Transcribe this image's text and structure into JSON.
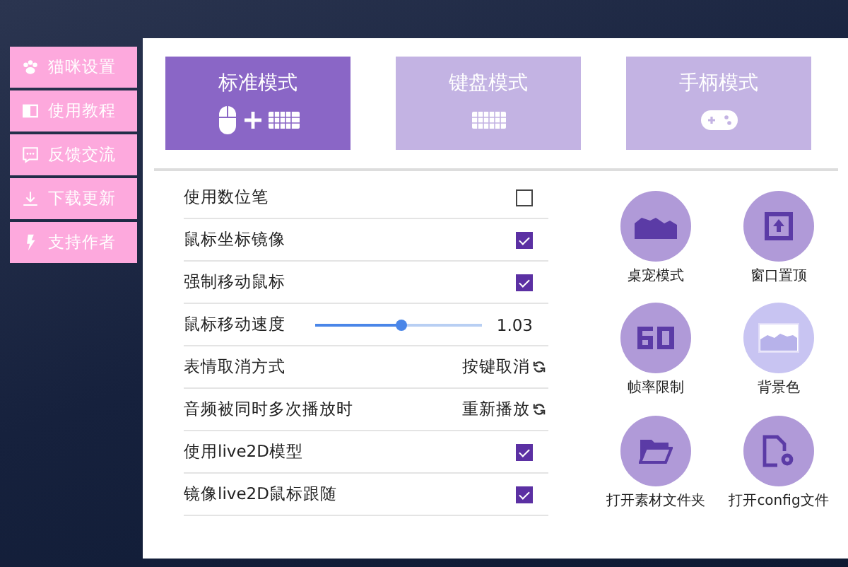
{
  "sidebar": {
    "items": [
      {
        "label": "猫咪设置"
      },
      {
        "label": "使用教程"
      },
      {
        "label": "反馈交流"
      },
      {
        "label": "下载更新"
      },
      {
        "label": "支持作者"
      }
    ]
  },
  "modes": [
    {
      "label": "标准模式",
      "selected": true
    },
    {
      "label": "键盘模式",
      "selected": false
    },
    {
      "label": "手柄模式",
      "selected": false
    }
  ],
  "settings": [
    {
      "kind": "checkbox",
      "label": "使用数位笔",
      "checked": false
    },
    {
      "kind": "checkbox",
      "label": "鼠标坐标镜像",
      "checked": true
    },
    {
      "kind": "checkbox",
      "label": "强制移动鼠标",
      "checked": true
    },
    {
      "kind": "slider",
      "label": "鼠标移动速度",
      "level": 0.51,
      "reading": "1.03"
    },
    {
      "kind": "cycle",
      "label": "表情取消方式",
      "value": "按键取消"
    },
    {
      "kind": "cycle",
      "label": "音频被同时多次播放时",
      "value": "重新播放"
    },
    {
      "kind": "checkbox",
      "label": "使用live2D模型",
      "checked": true
    },
    {
      "kind": "checkbox",
      "label": "镜像live2D鼠标跟随",
      "checked": true
    }
  ],
  "tools": [
    {
      "label": "桌宠模式",
      "color": "#b09ad8"
    },
    {
      "label": "窗口置顶",
      "color": "#b09ad8"
    },
    {
      "label": "帧率限制",
      "color": "#b09ad8"
    },
    {
      "label": "背景色",
      "color": "#c8c4f2"
    },
    {
      "label": "打开素材文件夹",
      "color": "#b09ad8"
    },
    {
      "label": "打开config文件",
      "color": "#b09ad8"
    }
  ]
}
